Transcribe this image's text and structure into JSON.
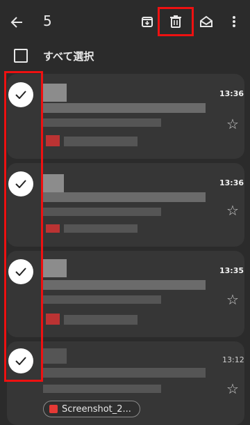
{
  "toolbar": {
    "selected_count": "5",
    "icons": [
      "back-arrow-icon",
      "archive-icon",
      "trash-icon",
      "mark-read-icon",
      "more-vert-icon"
    ]
  },
  "select_all": {
    "label": "すべて選択"
  },
  "emails": [
    {
      "time": "13:36",
      "unread": true,
      "selected": true
    },
    {
      "time": "13:36",
      "unread": true,
      "selected": true
    },
    {
      "time": "13:35",
      "unread": true,
      "selected": true
    },
    {
      "time": "13:12",
      "unread": false,
      "selected": true,
      "attachment": "Screenshot_2..."
    }
  ],
  "colors": {
    "highlight": "#ee1111",
    "background": "#2b2b2b",
    "card": "#363636"
  }
}
